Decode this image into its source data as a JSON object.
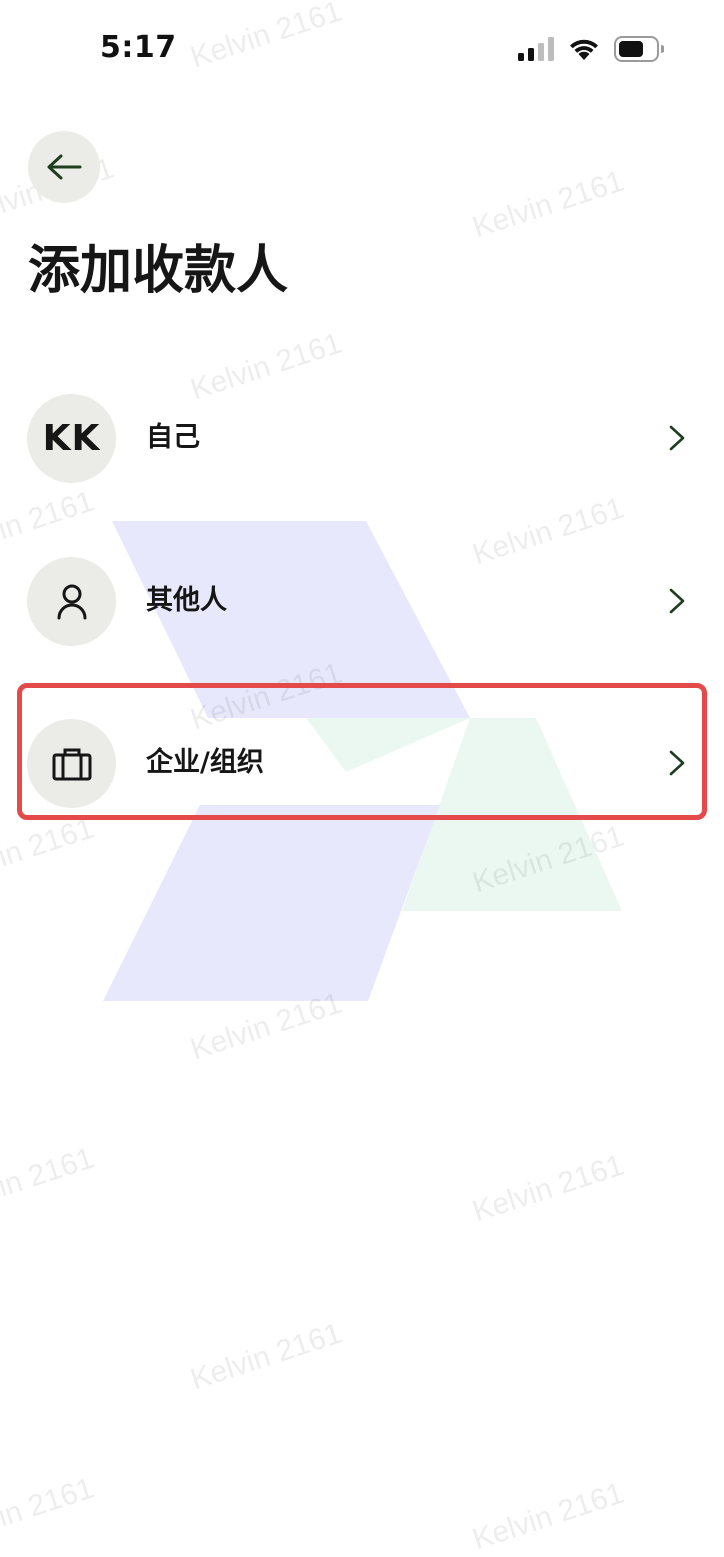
{
  "status_bar": {
    "time": "5:17",
    "icons": [
      "cellular-signal-icon",
      "wifi-icon",
      "battery-icon"
    ]
  },
  "header": {
    "back_icon": "arrow-left-icon",
    "title": "添加收款人"
  },
  "payees": [
    {
      "avatar_initials": "KK",
      "label": "自己",
      "icon": "chevron-right-icon"
    },
    {
      "avatar_icon": "person-icon",
      "label": "其他人",
      "icon": "chevron-right-icon"
    },
    {
      "avatar_icon": "briefcase-icon",
      "label": "企业/组织",
      "icon": "chevron-right-icon",
      "highlighted": true
    }
  ],
  "watermark": {
    "text": "Kelvin 2161"
  },
  "colors": {
    "avatar_bg": "#ebebe7",
    "highlight": "#e54a4a",
    "icon_dark": "#1f3d1f",
    "shape_blue": "#e7e8fb",
    "shape_green": "#eaf8f1"
  }
}
